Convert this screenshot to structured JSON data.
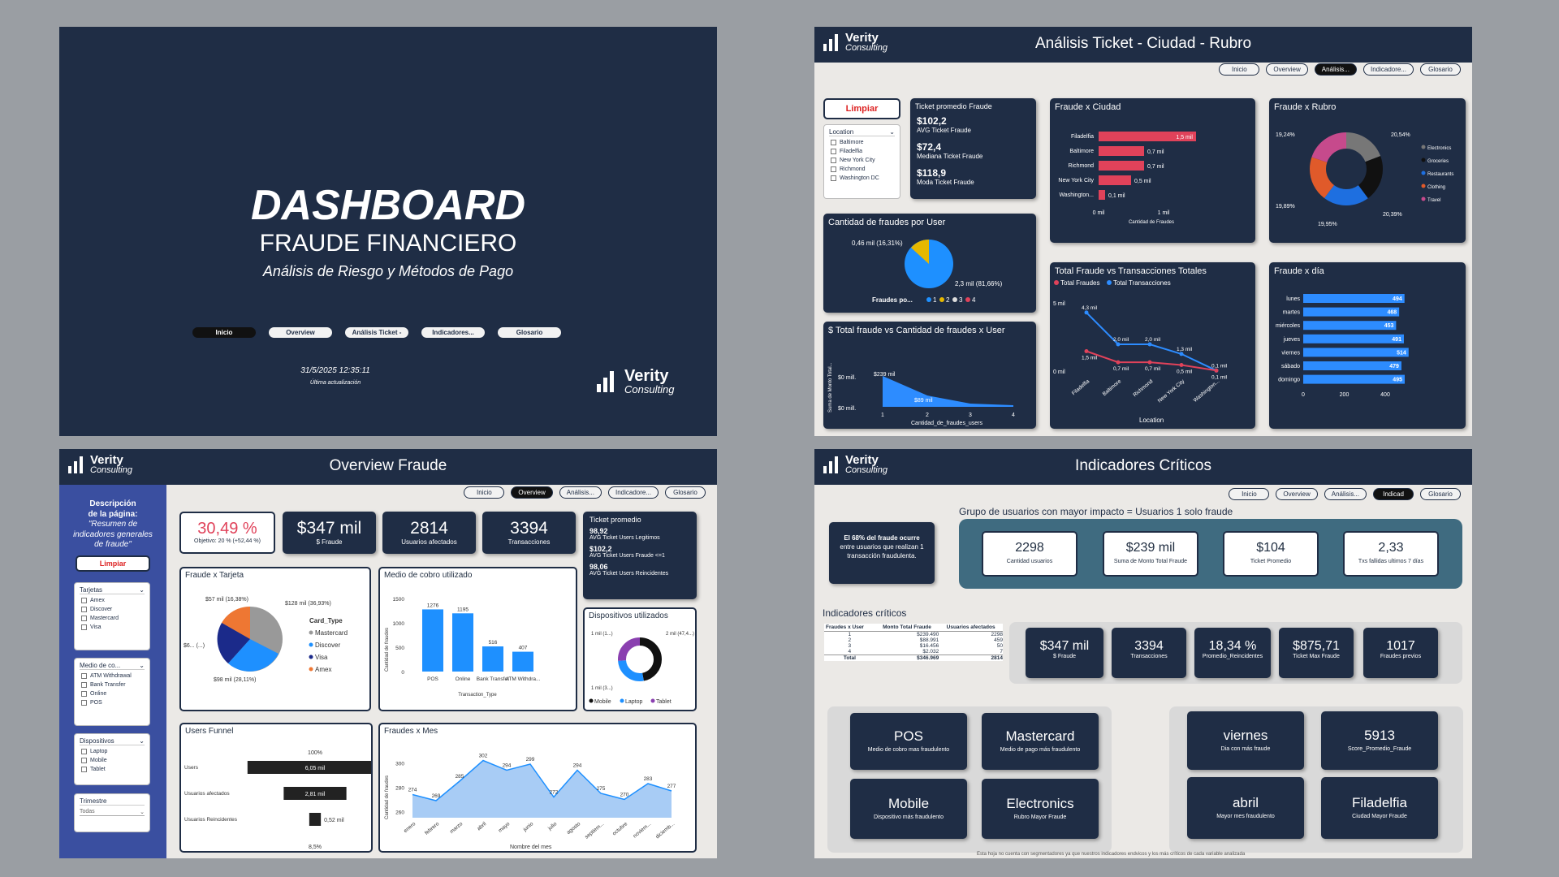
{
  "cover": {
    "title": "DASHBOARD",
    "subtitle": "FRAUDE FINANCIERO",
    "tagline": "Análisis de Riesgo y Métodos de Pago",
    "nav": [
      "Inicio",
      "Overview",
      "Análisis Ticket -",
      "Indicadores...",
      "Glosario"
    ],
    "date": "31/5/2025 12:35:11",
    "date_label": "Última actualización"
  },
  "brand": {
    "name": "Verity",
    "sub": "Consulting"
  },
  "analysis": {
    "title": "Análisis Ticket - Ciudad - Rubro",
    "nav": [
      "Inicio",
      "Overview",
      "Análisis...",
      "Indicadore...",
      "Glosario"
    ],
    "clear": "Limpiar",
    "location": {
      "title": "Location",
      "items": [
        "Baltimore",
        "Filadelfia",
        "New York City",
        "Richmond",
        "Washington DC"
      ]
    },
    "ticket": {
      "title": "Ticket promedio Fraude",
      "rows": [
        {
          "v": "$102,2",
          "l": "AVG Ticket Fraude"
        },
        {
          "v": "$72,4",
          "l": "Mediana Ticket Fraude"
        },
        {
          "v": "$118,9",
          "l": "Moda Ticket Fraude"
        }
      ]
    },
    "per_user": {
      "title": "Cantidad de fraudes por User",
      "lbl1": "0,46 mil (16,31%)",
      "lbl2": "2,3 mil (81,66%)",
      "legend_title": "Fraudes po...",
      "legend": [
        "1",
        "2",
        "3",
        "4"
      ]
    },
    "total_vs": {
      "title": "$ Total fraude vs Cantidad de fraudes x User",
      "ylabel": "Suma de Monto Total...",
      "xlabel": "Cantidad_de_fraudes_users",
      "y0": "$0 mill.",
      "y1": "$0 mill.",
      "l1": "$239 mil",
      "l2": "$89 mil",
      "ticks": [
        "1",
        "2",
        "3",
        "4"
      ]
    },
    "city": {
      "title": "Fraude x Ciudad",
      "xlabel": "Cantidad de Fraudes",
      "ticks": [
        "0 mil",
        "1 mil"
      ],
      "cats": [
        "Filadelfia",
        "Baltimore",
        "Richmond",
        "New York City",
        "Washington..."
      ],
      "labels": [
        "1,5 mil",
        "0,7 mil",
        "0,7 mil",
        "0,5 mil",
        "0,1 mil"
      ]
    },
    "rubro": {
      "title": "Fraude x Rubro",
      "legend": [
        "Electronics",
        "Groceries",
        "Restaurants",
        "Clothing",
        "Travel"
      ],
      "labels": [
        "19,24%",
        "20,54%",
        "20,39%",
        "19,95%",
        "19,89%"
      ]
    },
    "tx": {
      "title": "Total Fraude vs Transacciones Totales",
      "legend": [
        "Total Fraudes",
        "Total Transacciones"
      ],
      "y5": "5 mil",
      "y0": "0 mil",
      "xlabel": "Location",
      "cats": [
        "Filadelfia",
        "Baltimore",
        "Richmond",
        "New York City",
        "Washington..."
      ],
      "top": [
        "4,3 mil",
        "2,0 mil",
        "2,0 mil",
        "1,3 mil",
        "0,1 mil"
      ],
      "bot": [
        "1,5 mil",
        "0,7 mil",
        "0,7 mil",
        "0,5 mil",
        "0,1 mil"
      ]
    },
    "dia": {
      "title": "Fraude x día",
      "cats": [
        "lunes",
        "martes",
        "miércoles",
        "jueves",
        "viernes",
        "sábado",
        "domingo"
      ],
      "labels": [
        "494",
        "468",
        "453",
        "491",
        "514",
        "479",
        "495"
      ],
      "ticks": [
        "0",
        "200",
        "400"
      ]
    }
  },
  "overview": {
    "title": "Overview Fraude",
    "nav": [
      "Inicio",
      "Overview",
      "Análisis...",
      "Indicadore...",
      "Glosario"
    ],
    "desc": [
      "Descripción",
      "de la página:",
      "\"Resumen de",
      "indicadores generales",
      "de fraude\""
    ],
    "clear": "Limpiar",
    "slicers": [
      {
        "t": "Tarjetas",
        "items": [
          "Amex",
          "Discover",
          "Mastercard",
          "Visa"
        ]
      },
      {
        "t": "Medio de co...",
        "items": [
          "ATM Withdrawal",
          "Bank Transfer",
          "Online",
          "POS"
        ]
      },
      {
        "t": "Dispositivos",
        "items": [
          "Laptop",
          "Mobile",
          "Tablet"
        ]
      }
    ],
    "trim": {
      "t": "Trimestre",
      "v": "Todas"
    },
    "kpi_pct": "30,49 %",
    "kpi_pct_sub": "Objetivo: 20 % (+52,44 %)",
    "kpis": [
      {
        "v": "$347 mil",
        "l": "$ Fraude"
      },
      {
        "v": "2814",
        "l": "Usuarios afectados"
      },
      {
        "v": "3394",
        "l": "Transacciones"
      }
    ],
    "ticket": {
      "t": "Ticket promedio",
      "rows": [
        {
          "v": "98,92",
          "l": "AVG Ticket Users Legitimos"
        },
        {
          "v": "$102,2",
          "l": "AVG Ticket Users Fraude <=1"
        },
        {
          "v": "98,06",
          "l": "AVG Ticket Users Reincidentes"
        }
      ]
    },
    "tarjeta": {
      "t": "Fraude x Tarjeta",
      "legend_title": "Card_Type",
      "legend": [
        "Mastercard",
        "Discover",
        "Visa",
        "Amex"
      ],
      "labels": [
        "$57 mil (16,38%)",
        "$128 mil (36,93%)",
        "$6... (...)",
        "$98 mil (28,11%)"
      ]
    },
    "medio": {
      "t": "Medio de cobro utilizado",
      "ylabel": "Cantidad de fraudes",
      "xlabel": "Transaction_Type",
      "cats": [
        "POS",
        "Online",
        "Bank Transfer",
        "ATM Withdra..."
      ],
      "labels": [
        "1276",
        "1195",
        "516",
        "407"
      ],
      "ticks": [
        "1500",
        "1000",
        "500",
        "0"
      ]
    },
    "disp": {
      "t": "Dispositivos utilizados",
      "l1": "1 mil (1...)",
      "l2": "2 mil (47,4...)",
      "l3": "1 mil (3...)",
      "legend": [
        "Mobile",
        "Laptop",
        "Tablet"
      ]
    },
    "funnel": {
      "t": "Users Funnel",
      "top": "100%",
      "rows": [
        "Users",
        "Usuarios afectados",
        "Usuarios Reincidentes"
      ],
      "vals": [
        "6,05 mil",
        "2,81 mil",
        "0,52 mil"
      ],
      "bottom": "8,5%"
    },
    "mes": {
      "t": "Fraudes x Mes",
      "ylabel": "Cantidad de fraudes",
      "xlabel": "Nombre del mes",
      "cats": [
        "enero",
        "febrero",
        "marzo",
        "abril",
        "mayo",
        "junio",
        "julio",
        "agosto",
        "septiem...",
        "octubre",
        "noviem...",
        "diciemb..."
      ],
      "labels": [
        "274",
        "269",
        "285",
        "302",
        "294",
        "299",
        "272",
        "294",
        "275",
        "270",
        "283",
        "277"
      ],
      "ticks": [
        "300",
        "280",
        "260"
      ]
    }
  },
  "indicadores": {
    "title": "Indicadores Críticos",
    "nav": [
      "Inicio",
      "Overview",
      "Análisis...",
      "Indicad",
      "Glosario"
    ],
    "group_title": "Grupo de usuarios con mayor impacto = Usuarios 1 solo fraude",
    "note": [
      "El 68% del fraude ocurre",
      "entre usuarios que realizan 1",
      "transacción fraudulenta."
    ],
    "gkpis": [
      {
        "v": "2298",
        "l": "Cantidad usuarios"
      },
      {
        "v": "$239 mil",
        "l": "Suma de Monto Total Fraude"
      },
      {
        "v": "$104",
        "l": "Ticket Promedio"
      },
      {
        "v": "2,33",
        "l": "Txs fallidas ultimos 7 días"
      }
    ],
    "crit_title": "Indicadores críticos",
    "table": {
      "headers": [
        "Fraudes x User",
        "Monto Total Fraude",
        "Usuarios afectados"
      ],
      "rows": [
        [
          "1",
          "$239.490",
          "2298"
        ],
        [
          "2",
          "$88.991",
          "459"
        ],
        [
          "3",
          "$16.456",
          "50"
        ],
        [
          "4",
          "$2.032",
          "7"
        ],
        [
          "Total",
          "$346.969",
          "2814"
        ]
      ]
    },
    "ckpis": [
      {
        "v": "$347 mil",
        "l": "$ Fraude"
      },
      {
        "v": "3394",
        "l": "Transacciones"
      },
      {
        "v": "18,34 %",
        "l": "Promedio_Reincidentes"
      },
      {
        "v": "$875,71",
        "l": "Ticket Max Fraude"
      },
      {
        "v": "1017",
        "l": "Fraudes previos"
      }
    ],
    "tiles": [
      {
        "v": "POS",
        "l": "Medio de cobro mas fraudulento"
      },
      {
        "v": "Mastercard",
        "l": "Medio de pago más fraudulento"
      },
      {
        "v": "Mobile",
        "l": "Dispositivo más fraudulento"
      },
      {
        "v": "Electronics",
        "l": "Rubro Mayor Fraude"
      },
      {
        "v": "viernes",
        "l": "Dia con más fraude"
      },
      {
        "v": "5913",
        "l": "Score_Promedio_Fraude"
      },
      {
        "v": "abril",
        "l": "Mayor mes fraudulento"
      },
      {
        "v": "Filadelfia",
        "l": "Ciudad Mayor Fraude"
      }
    ],
    "footer": "Esta hoja no cuenta con segmentadores ya que nuestros indicadores endvicos y los más críticos de cada variable analizada"
  }
}
